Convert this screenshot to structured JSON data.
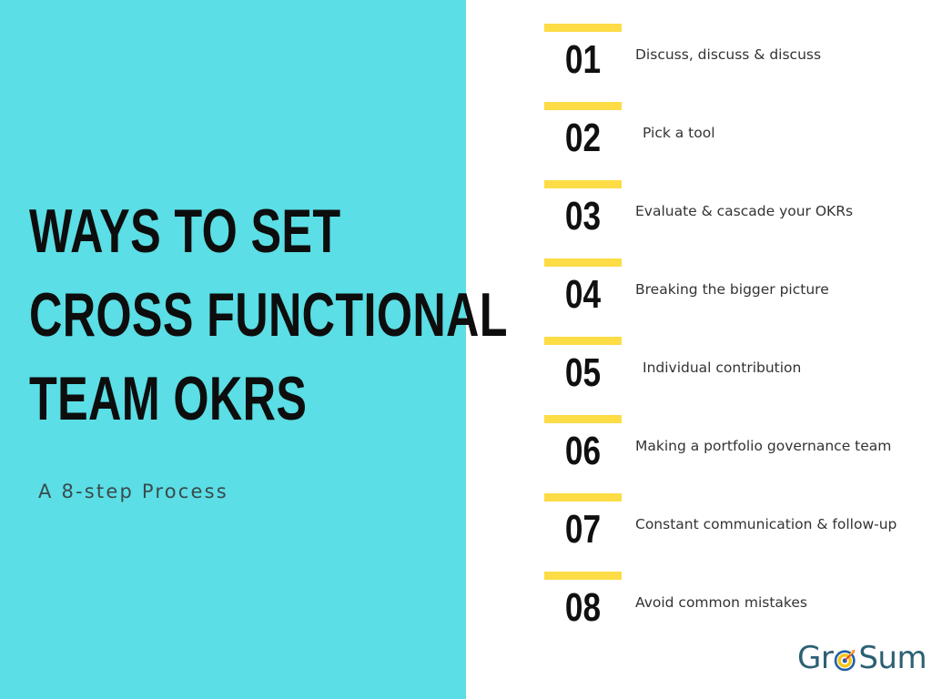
{
  "colors": {
    "panel_teal": "#5BDEE5",
    "accent_yellow": "#FDDC45",
    "title_black": "#0D0D0D",
    "label_gray": "#333333",
    "subtitle_gray": "#3A4A4D",
    "logo_teal": "#2C6073",
    "logo_ring_blue": "#1F5FA8",
    "logo_ring_yellow": "#F5C518",
    "logo_dart_red": "#E8442E",
    "background_white": "#FFFFFF"
  },
  "hero": {
    "title_lines": [
      "WAYS TO SET",
      "CROSS FUNCTIONAL",
      "TEAM OKRS"
    ],
    "subtitle": "A 8-step Process"
  },
  "steps": [
    {
      "number": "01",
      "label": "Discuss, discuss & discuss",
      "indented": false
    },
    {
      "number": "02",
      "label": "Pick a tool",
      "indented": true
    },
    {
      "number": "03",
      "label": "Evaluate & cascade your OKRs",
      "indented": false
    },
    {
      "number": "04",
      "label": "Breaking the bigger picture",
      "indented": false
    },
    {
      "number": "05",
      "label": "Individual contribution",
      "indented": true
    },
    {
      "number": "06",
      "label": "Making a portfolio governance team",
      "indented": false
    },
    {
      "number": "07",
      "label": "Constant communication & follow-up",
      "indented": false
    },
    {
      "number": "08",
      "label": "Avoid common mistakes",
      "indented": false
    }
  ],
  "logo": {
    "text_before": "Gr",
    "icon": "target-bullseye-icon",
    "text_after": "Sum",
    "full_name": "GroSum"
  }
}
